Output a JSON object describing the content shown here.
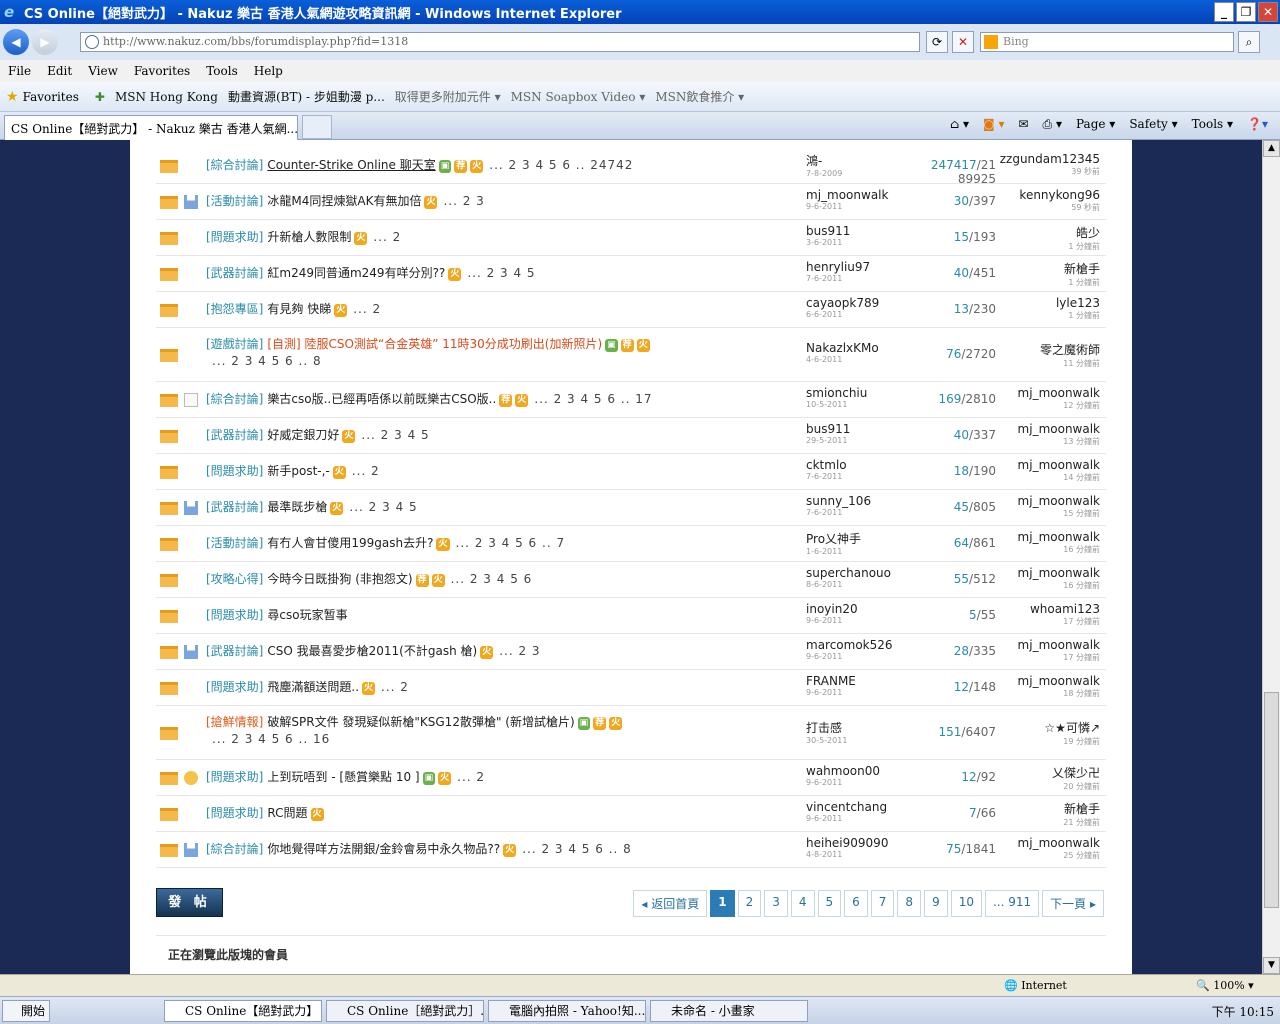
{
  "browser": {
    "window_title": "CS Online【絕對武力】 - Nakuz 樂古 香港人氣網遊攻略資訊網 - Windows Internet Explorer",
    "address": "http://www.nakuz.com/bbs/forumdisplay.php?fid=1318",
    "search_placeholder": "Bing",
    "menu": [
      "File",
      "Edit",
      "View",
      "Favorites",
      "Tools",
      "Help"
    ],
    "favorites_label": "Favorites",
    "fav_items": [
      "MSN Hong Kong",
      "動畫資源(BT) - 步姐動漫 p...",
      "取得更多附加元件 ▾",
      "MSN Soapbox Video ▾",
      "MSN飲食推介 ▾"
    ],
    "tab_title": "CS Online【絕對武力】 - Nakuz 樂古 香港人氣網...",
    "cmd": [
      "Page ▾",
      "Safety ▾",
      "Tools ▾"
    ],
    "status_zone": "Internet",
    "zoom": "100%"
  },
  "threads": [
    {
      "icon": "",
      "cat": "[綜合討論]",
      "title": "Counter-Strike Online 聊天室",
      "badges": [
        "▣",
        "荐",
        "火"
      ],
      "pages": "... 2 3 4 5 6 .. 24742",
      "author": "鴻-",
      "date": "7-8-2009",
      "replies": "247417",
      "views": "21 89925",
      "last": "zzgundam12345",
      "last_time": "39 秒前"
    },
    {
      "icon": "bar",
      "cat": "[活動討論]",
      "title": "冰龍M4同捏煉獄AK有無加倍",
      "badges": [
        "火"
      ],
      "pages": "... 2 3",
      "author": "mj_moonwalk",
      "date": "9-6-2011",
      "replies": "30",
      "views": "397",
      "last": "kennykong96",
      "last_time": "59 秒前"
    },
    {
      "icon": "",
      "cat": "[問題求助]",
      "title": "升新槍人數限制",
      "badges": [
        "火"
      ],
      "pages": "... 2",
      "author": "bus911",
      "date": "3-6-2011",
      "replies": "15",
      "views": "193",
      "last": "皓少",
      "last_time": "1 分鐘前"
    },
    {
      "icon": "",
      "cat": "[武器討論]",
      "title": "紅m249同普通m249有咩分別??",
      "badges": [
        "火"
      ],
      "pages": "... 2 3 4 5",
      "author": "henryliu97",
      "date": "7-6-2011",
      "replies": "40",
      "views": "451",
      "last": "新槍手",
      "last_time": "1 分鐘前"
    },
    {
      "icon": "",
      "cat": "[抱怨專區]",
      "title": "有見夠 快睇",
      "badges": [
        "火"
      ],
      "pages": "... 2",
      "author": "cayaopk789",
      "date": "6-6-2011",
      "replies": "13",
      "views": "230",
      "last": "lyle123",
      "last_time": "1 分鐘前"
    },
    {
      "icon": "",
      "cat": "[遊戲討論]",
      "title": "[自測] 陸服CSO測試“合金英雄” 11時30分成功刷出(加新照片)",
      "badges": [
        "▣",
        "荐",
        "火"
      ],
      "pages": "... 2 3 4 5 6 .. 8",
      "author": "NakazlxKMo",
      "date": "4-6-2011",
      "replies": "76",
      "views": "2720",
      "last": "零之魔術師",
      "last_time": "11 分鐘前",
      "tall": true,
      "red": true
    },
    {
      "icon": "doc",
      "cat": "[綜合討論]",
      "title": "樂古cso版..已經再唔係以前既樂古CSO版..",
      "badges": [
        "荐",
        "火"
      ],
      "pages": "... 2 3 4 5 6 .. 17",
      "author": "smionchiu",
      "date": "10-5-2011",
      "replies": "169",
      "views": "2810",
      "last": "mj_moonwalk",
      "last_time": "12 分鐘前"
    },
    {
      "icon": "",
      "cat": "[武器討論]",
      "title": "好威定銀刀好",
      "badges": [
        "火"
      ],
      "pages": "... 2 3 4 5",
      "author": "bus911",
      "date": "29-5-2011",
      "replies": "40",
      "views": "337",
      "last": "mj_moonwalk",
      "last_time": "13 分鐘前"
    },
    {
      "icon": "",
      "cat": "[問題求助]",
      "title": "新手post-,-",
      "badges": [
        "火"
      ],
      "pages": "... 2",
      "author": "cktmlo",
      "date": "7-6-2011",
      "replies": "18",
      "views": "190",
      "last": "mj_moonwalk",
      "last_time": "14 分鐘前"
    },
    {
      "icon": "bar",
      "cat": "[武器討論]",
      "title": "最準既步槍",
      "badges": [
        "火"
      ],
      "pages": "... 2 3 4 5",
      "author": "sunny_106",
      "date": "7-6-2011",
      "replies": "45",
      "views": "805",
      "last": "mj_moonwalk",
      "last_time": "15 分鐘前"
    },
    {
      "icon": "",
      "cat": "[活動討論]",
      "title": "有冇人會甘傻用199gash去升?",
      "badges": [
        "火"
      ],
      "pages": "... 2 3 4 5 6 .. 7",
      "author": "Pro乂神手",
      "date": "1-6-2011",
      "replies": "64",
      "views": "861",
      "last": "mj_moonwalk",
      "last_time": "16 分鐘前"
    },
    {
      "icon": "",
      "cat": "[攻略心得]",
      "title": "今時今日既掛狗 (非抱怨文)",
      "badges": [
        "荐",
        "火"
      ],
      "pages": "... 2 3 4 5 6",
      "author": "superchanouo",
      "date": "8-6-2011",
      "replies": "55",
      "views": "512",
      "last": "mj_moonwalk",
      "last_time": "16 分鐘前"
    },
    {
      "icon": "",
      "cat": "[問題求助]",
      "title": "尋cso玩家暂事",
      "badges": [],
      "pages": "",
      "author": "inoyin20",
      "date": "9-6-2011",
      "replies": "5",
      "views": "55",
      "last": "whoami123",
      "last_time": "17 分鐘前"
    },
    {
      "icon": "bar",
      "cat": "[武器討論]",
      "title": "CSO 我最喜愛步槍2011(不計gash 槍)",
      "badges": [
        "火"
      ],
      "pages": "... 2 3",
      "author": "marcomok526",
      "date": "9-6-2011",
      "replies": "28",
      "views": "335",
      "last": "mj_moonwalk",
      "last_time": "17 分鐘前"
    },
    {
      "icon": "",
      "cat": "[問題求助]",
      "title": "飛塵滿額送問題..",
      "badges": [
        "火"
      ],
      "pages": "... 2",
      "author": "FRANME",
      "date": "9-6-2011",
      "replies": "12",
      "views": "148",
      "last": "mj_moonwalk",
      "last_time": "18 分鐘前"
    },
    {
      "icon": "",
      "cat": "[搶鮮情報]",
      "title": "破解SPR文件 發現疑似新槍\"KSG12散彈槍\" (新增試槍片)",
      "badges": [
        "▣",
        "荐",
        "火"
      ],
      "pages": "... 2 3 4 5 6 .. 16",
      "author": "打击感",
      "date": "30-5-2011",
      "replies": "151",
      "views": "6407",
      "last": "☆★可憐↗",
      "last_time": "19 分鐘前",
      "tall": true,
      "hotcat": true
    },
    {
      "icon": "face",
      "cat": "[問題求助]",
      "title": "上到玩唔到 - [懸賞樂點 10 ]",
      "badges": [
        "▣",
        "火"
      ],
      "pages": "... 2",
      "author": "wahmoon00",
      "date": "9-6-2011",
      "replies": "12",
      "views": "92",
      "last": "乂傑少卍",
      "last_time": "20 分鐘前"
    },
    {
      "icon": "",
      "cat": "[問題求助]",
      "title": "RC問題",
      "badges": [
        "火"
      ],
      "pages": "",
      "author": "vincentchang",
      "date": "9-6-2011",
      "replies": "7",
      "views": "66",
      "last": "新槍手",
      "last_time": "21 分鐘前"
    },
    {
      "icon": "bar",
      "cat": "[綜合討論]",
      "title": "你地覺得咩方法開銀/金鈴會易中永久物品??",
      "badges": [
        "火"
      ],
      "pages": "... 2 3 4 5 6 .. 8",
      "author": "heihei909090",
      "date": "4-8-2011",
      "replies": "75",
      "views": "1841",
      "last": "mj_moonwalk",
      "last_time": "25 分鐘前"
    }
  ],
  "post_button": "發 帖",
  "pager": {
    "back": "◂ 返回首頁",
    "pages": [
      "1",
      "2",
      "3",
      "4",
      "5",
      "6",
      "7",
      "8",
      "9",
      "10",
      "... 911"
    ],
    "next": "下一頁 ▸"
  },
  "online_title": "正在瀏覽此版塊的會員",
  "taskbar": {
    "start": "開始",
    "buttons": [
      "CS Online【絕對武力】 ...",
      "CS Online［絕對武力］...",
      "電腦內拍照 - Yahoo!知...",
      "未命名 - 小畫家"
    ],
    "clock": "下午 10:15"
  }
}
